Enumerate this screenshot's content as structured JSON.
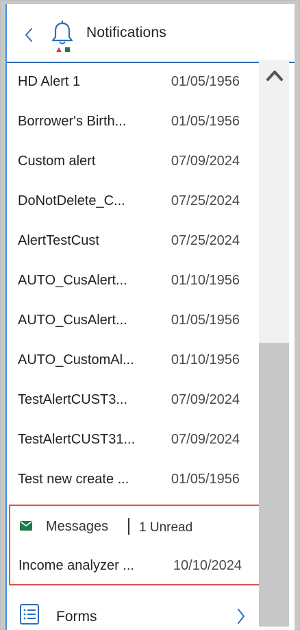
{
  "header": {
    "title": "Notifications",
    "back_icon": "chevron-left-icon",
    "bell_icon": "bell-icon"
  },
  "notifications": [
    {
      "name": "HD Alert 1",
      "date": "01/05/1956"
    },
    {
      "name": "Borrower's Birth...",
      "date": "01/05/1956"
    },
    {
      "name": "Custom alert",
      "date": "07/09/2024"
    },
    {
      "name": "DoNotDelete_C...",
      "date": "07/25/2024"
    },
    {
      "name": "AlertTestCust",
      "date": "07/25/2024"
    },
    {
      "name": "AUTO_CusAlert...",
      "date": "01/10/1956"
    },
    {
      "name": "AUTO_CusAlert...",
      "date": "01/05/1956"
    },
    {
      "name": "AUTO_CustomAl...",
      "date": "01/10/1956"
    },
    {
      "name": "TestAlertCUST3...",
      "date": "07/09/2024"
    },
    {
      "name": "TestAlertCUST31...",
      "date": "07/09/2024"
    },
    {
      "name": "Test new create ...",
      "date": "01/05/1956"
    }
  ],
  "messages": {
    "title": "Messages",
    "unread": "1 Unread",
    "item": {
      "name": "Income analyzer ...",
      "date": "10/10/2024"
    },
    "highlight_color": "#e05050"
  },
  "forms": {
    "label": "Forms"
  },
  "colors": {
    "header_border": "#2e6fb5",
    "accent_green": "#1f7a4d",
    "accent_red": "#d83a52"
  }
}
